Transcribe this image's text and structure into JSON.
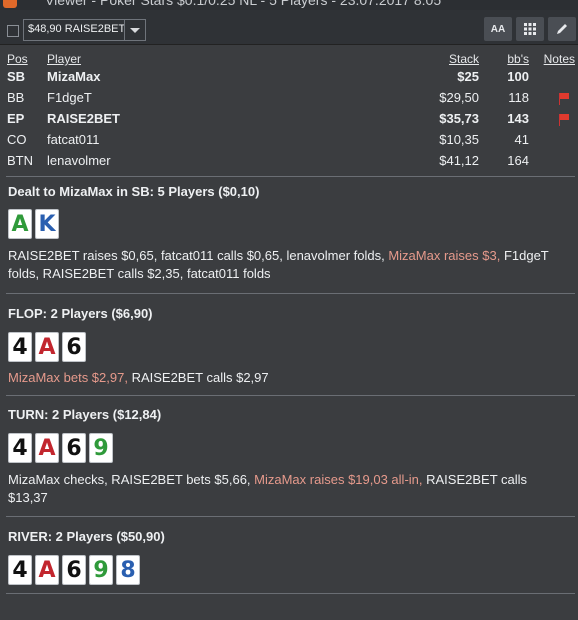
{
  "window": {
    "title": "Viewer - Poker Stars $0.1/0.25 NL - 5 Players - 23.07.2017 8:05"
  },
  "toolbar": {
    "player_select": "$48,90 RAISE2BET",
    "font_button": "AA"
  },
  "table": {
    "headers": {
      "pos": "Pos",
      "player": "Player",
      "stack": "Stack",
      "bbs": "bb's",
      "notes": "Notes"
    },
    "rows": [
      {
        "pos": "SB",
        "player": "MizaMax",
        "stack": "$25",
        "bbs": "100",
        "bold": true,
        "note": false
      },
      {
        "pos": "BB",
        "player": "F1dgeT",
        "stack": "$29,50",
        "bbs": "118",
        "bold": false,
        "note": true
      },
      {
        "pos": "EP",
        "player": "RAISE2BET",
        "stack": "$35,73",
        "bbs": "143",
        "bold": true,
        "note": true
      },
      {
        "pos": "CO",
        "player": "fatcat011",
        "stack": "$10,35",
        "bbs": "41",
        "bold": false,
        "note": false
      },
      {
        "pos": "BTN",
        "player": "lenavolmer",
        "stack": "$41,12",
        "bbs": "164",
        "bold": false,
        "note": false
      }
    ]
  },
  "colors": {
    "hero_action": "#e69a8c",
    "note_flag": "#e03a2e"
  },
  "preflop": {
    "title": "Dealt to MizaMax in SB: 5 Players ($0,10)",
    "cards": [
      {
        "rank": "A",
        "color": "#2f9a3a"
      },
      {
        "rank": "K",
        "color": "#2a5fb0"
      }
    ],
    "actions": [
      {
        "text": "RAISE2BET raises $0,65, fatcat011 calls $0,65, lenavolmer folds, ",
        "hl": false
      },
      {
        "text": "MizaMax raises $3,",
        "hl": true
      },
      {
        "text": " F1dgeT folds, RAISE2BET calls $2,35, fatcat011 folds",
        "hl": false
      }
    ]
  },
  "flop": {
    "title": "FLOP: 2 Players ($6,90)",
    "cards": [
      {
        "rank": "4",
        "color": "#111111"
      },
      {
        "rank": "A",
        "color": "#c2262e"
      },
      {
        "rank": "6",
        "color": "#111111"
      }
    ],
    "actions": [
      {
        "text": "MizaMax bets $2,97,",
        "hl": true
      },
      {
        "text": " RAISE2BET calls $2,97",
        "hl": false
      }
    ]
  },
  "turn": {
    "title": "TURN: 2 Players ($12,84)",
    "cards": [
      {
        "rank": "4",
        "color": "#111111"
      },
      {
        "rank": "A",
        "color": "#c2262e"
      },
      {
        "rank": "6",
        "color": "#111111"
      },
      {
        "rank": "9",
        "color": "#2f9a3a"
      }
    ],
    "actions": [
      {
        "text": "MizaMax checks, RAISE2BET bets $5,66, ",
        "hl": false
      },
      {
        "text": "MizaMax raises $19,03 all-in,",
        "hl": true
      },
      {
        "text": " RAISE2BET calls $13,37",
        "hl": false
      }
    ]
  },
  "river": {
    "title": "RIVER: 2 Players ($50,90)",
    "cards": [
      {
        "rank": "4",
        "color": "#111111"
      },
      {
        "rank": "A",
        "color": "#c2262e"
      },
      {
        "rank": "6",
        "color": "#111111"
      },
      {
        "rank": "9",
        "color": "#2f9a3a"
      },
      {
        "rank": "8",
        "color": "#2a5fb0"
      }
    ]
  }
}
